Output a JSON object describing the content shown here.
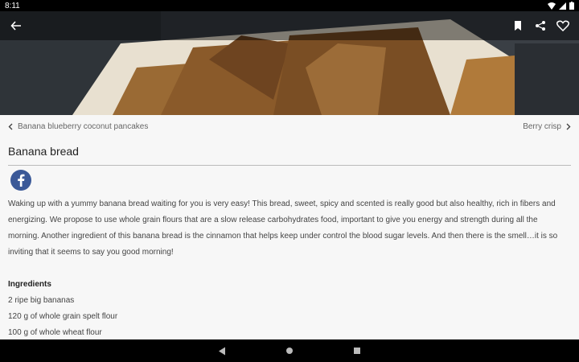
{
  "status": {
    "time": "8:11"
  },
  "toolbar": {
    "back_icon": "arrow-left-icon",
    "bookmark_icon": "bookmark-icon",
    "share_icon": "share-icon",
    "favorite_icon": "heart-icon"
  },
  "nav": {
    "prev_label": "Banana blueberry coconut pancakes",
    "next_label": "Berry crisp"
  },
  "recipe": {
    "title": "Banana bread",
    "description": "Waking up with a yummy banana bread waiting for you is very easy! This bread, sweet, spicy and scented is really good but also healthy, rich in fibers and energizing. We propose to use whole grain flours that are a slow release carbohydrates food, important to give you energy and strength during all the morning. Another ingredient of this banana bread is the cinnamon that helps keep under control the blood sugar levels. And then there is the smell…it is so inviting that it seems to say you good morning!",
    "ingredients_title": "Ingredients",
    "ingredients": [
      "2 ripe big bananas",
      "120 g of whole grain spelt flour",
      "100 g of whole wheat flour"
    ]
  },
  "colors": {
    "facebook": "#3b5998",
    "background": "#f7f7f7"
  }
}
